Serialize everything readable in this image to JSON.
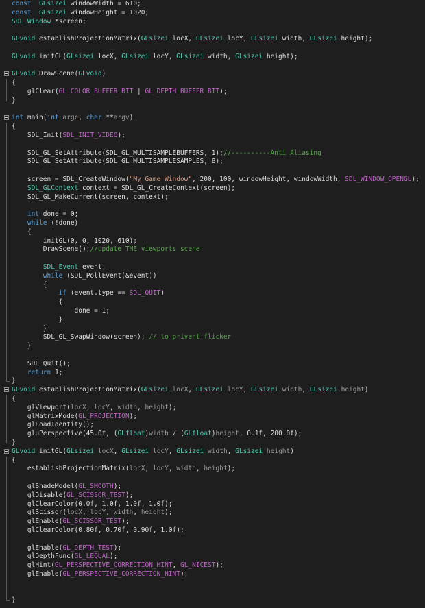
{
  "lines": [
    [
      [
        "kw",
        "const  "
      ],
      [
        "typ",
        "GLsizei"
      ],
      [
        "def",
        " windowWidth = 610;"
      ]
    ],
    [
      [
        "kw",
        "const  "
      ],
      [
        "typ",
        "GLsizei"
      ],
      [
        "def",
        " windowHeight = 1020;"
      ]
    ],
    [
      [
        "typ",
        "SDL_Window"
      ],
      [
        "def",
        " *screen;"
      ]
    ],
    [],
    [
      [
        "typ",
        "GLvoid"
      ],
      [
        "def",
        " establishProjectionMatrix("
      ],
      [
        "typ",
        "GLsizei"
      ],
      [
        "def",
        " locX, "
      ],
      [
        "typ",
        "GLsizei"
      ],
      [
        "def",
        " locY, "
      ],
      [
        "typ",
        "GLsizei"
      ],
      [
        "def",
        " width, "
      ],
      [
        "typ",
        "GLsizei"
      ],
      [
        "def",
        " height);"
      ]
    ],
    [],
    [
      [
        "typ",
        "GLvoid"
      ],
      [
        "def",
        " initGL("
      ],
      [
        "typ",
        "GLsizei"
      ],
      [
        "def",
        " locX, "
      ],
      [
        "typ",
        "GLsizei"
      ],
      [
        "def",
        " locY, "
      ],
      [
        "typ",
        "GLsizei"
      ],
      [
        "def",
        " width, "
      ],
      [
        "typ",
        "GLsizei"
      ],
      [
        "def",
        " height);"
      ]
    ],
    [],
    [
      [
        "typ",
        "GLvoid"
      ],
      [
        "def",
        " DrawScene("
      ],
      [
        "typ",
        "GLvoid"
      ],
      [
        "def",
        ")"
      ]
    ],
    [
      [
        "def",
        "{"
      ]
    ],
    [
      [
        "def",
        "    glClear("
      ],
      [
        "mac",
        "GL_COLOR_BUFFER_BIT"
      ],
      [
        "def",
        " | "
      ],
      [
        "mac",
        "GL_DEPTH_BUFFER_BIT"
      ],
      [
        "def",
        ");"
      ]
    ],
    [
      [
        "def",
        "}"
      ]
    ],
    [],
    [
      [
        "kw",
        "int"
      ],
      [
        "def",
        " main("
      ],
      [
        "kw",
        "int"
      ],
      [
        "par",
        " argc"
      ],
      [
        "def",
        ", "
      ],
      [
        "kw",
        "char"
      ],
      [
        "def",
        " **"
      ],
      [
        "par",
        "argv"
      ],
      [
        "def",
        ")"
      ]
    ],
    [
      [
        "def",
        "{"
      ]
    ],
    [
      [
        "def",
        "    SDL_Init("
      ],
      [
        "mac",
        "SDL_INIT_VIDEO"
      ],
      [
        "def",
        ");"
      ]
    ],
    [],
    [
      [
        "def",
        "    SDL_GL_SetAttribute(SDL_GL_MULTISAMPLEBUFFERS, 1);"
      ],
      [
        "com",
        "//----------Anti Aliasing"
      ]
    ],
    [
      [
        "def",
        "    SDL_GL_SetAttribute(SDL_GL_MULTISAMPLESAMPLES, 8);"
      ]
    ],
    [],
    [
      [
        "def",
        "    screen = SDL_CreateWindow("
      ],
      [
        "str",
        "\"My Game Window\""
      ],
      [
        "def",
        ", 200, 100, windowHeight, windowWidth, "
      ],
      [
        "mac",
        "SDL_WINDOW_OPENGL"
      ],
      [
        "def",
        ");"
      ]
    ],
    [
      [
        "def",
        "    "
      ],
      [
        "typ",
        "SDL_GLContext"
      ],
      [
        "def",
        " context = SDL_GL_CreateContext(screen);"
      ]
    ],
    [
      [
        "def",
        "    SDL_GL_MakeCurrent(screen, context);"
      ]
    ],
    [],
    [
      [
        "def",
        "    "
      ],
      [
        "kw",
        "int"
      ],
      [
        "def",
        " done = 0;"
      ]
    ],
    [
      [
        "def",
        "    "
      ],
      [
        "kw",
        "while"
      ],
      [
        "def",
        " (!done)"
      ]
    ],
    [
      [
        "def",
        "    {"
      ]
    ],
    [
      [
        "def",
        "        initGL(0, 0, 1020, 610);"
      ]
    ],
    [
      [
        "def",
        "        DrawScene();"
      ],
      [
        "com",
        "//update THE viewports scene"
      ]
    ],
    [],
    [
      [
        "def",
        "        "
      ],
      [
        "typ",
        "SDL_Event"
      ],
      [
        "def",
        " event;"
      ]
    ],
    [
      [
        "def",
        "        "
      ],
      [
        "kw",
        "while"
      ],
      [
        "def",
        " (SDL_PollEvent(&event))"
      ]
    ],
    [
      [
        "def",
        "        {"
      ]
    ],
    [
      [
        "def",
        "            "
      ],
      [
        "kw",
        "if"
      ],
      [
        "def",
        " (event.type == "
      ],
      [
        "mac",
        "SDL_QUIT"
      ],
      [
        "def",
        ")"
      ]
    ],
    [
      [
        "def",
        "            {"
      ]
    ],
    [
      [
        "def",
        "                done = 1;"
      ]
    ],
    [
      [
        "def",
        "            }"
      ]
    ],
    [
      [
        "def",
        "        }"
      ]
    ],
    [
      [
        "def",
        "        SDL_GL_SwapWindow(screen); "
      ],
      [
        "com",
        "// to privent flicker"
      ]
    ],
    [
      [
        "def",
        "    }"
      ]
    ],
    [],
    [
      [
        "def",
        "    SDL_Quit();"
      ]
    ],
    [
      [
        "def",
        "    "
      ],
      [
        "kw",
        "return"
      ],
      [
        "def",
        " 1;"
      ]
    ],
    [
      [
        "def",
        "}"
      ]
    ],
    [
      [
        "typ",
        "GLvoid"
      ],
      [
        "def",
        " establishProjectionMatrix("
      ],
      [
        "typ",
        "GLsizei"
      ],
      [
        "par",
        " locX"
      ],
      [
        "def",
        ", "
      ],
      [
        "typ",
        "GLsizei"
      ],
      [
        "par",
        " locY"
      ],
      [
        "def",
        ", "
      ],
      [
        "typ",
        "GLsizei"
      ],
      [
        "par",
        " width"
      ],
      [
        "def",
        ", "
      ],
      [
        "typ",
        "GLsizei"
      ],
      [
        "par",
        " height"
      ],
      [
        "def",
        ")"
      ]
    ],
    [
      [
        "def",
        "{"
      ]
    ],
    [
      [
        "def",
        "    glViewport("
      ],
      [
        "par",
        "locX"
      ],
      [
        "def",
        ", "
      ],
      [
        "par",
        "locY"
      ],
      [
        "def",
        ", "
      ],
      [
        "par",
        "width"
      ],
      [
        "def",
        ", "
      ],
      [
        "par",
        "height"
      ],
      [
        "def",
        ");"
      ]
    ],
    [
      [
        "def",
        "    glMatrixMode("
      ],
      [
        "mac",
        "GL_PROJECTION"
      ],
      [
        "def",
        ");"
      ]
    ],
    [
      [
        "def",
        "    glLoadIdentity();"
      ]
    ],
    [
      [
        "def",
        "    gluPerspective(45.0f, ("
      ],
      [
        "typ",
        "GLfloat"
      ],
      [
        "def",
        ")"
      ],
      [
        "par",
        "width"
      ],
      [
        "def",
        " / ("
      ],
      [
        "typ",
        "GLfloat"
      ],
      [
        "def",
        ")"
      ],
      [
        "par",
        "height"
      ],
      [
        "def",
        ", 0.1f, 200.0f);"
      ]
    ],
    [
      [
        "def",
        "}"
      ]
    ],
    [
      [
        "typ",
        "GLvoid"
      ],
      [
        "def",
        " initGL("
      ],
      [
        "typ",
        "GLsizei"
      ],
      [
        "par",
        " locX"
      ],
      [
        "def",
        ", "
      ],
      [
        "typ",
        "GLsizei"
      ],
      [
        "par",
        " locY"
      ],
      [
        "def",
        ", "
      ],
      [
        "typ",
        "GLsizei"
      ],
      [
        "par",
        " width"
      ],
      [
        "def",
        ", "
      ],
      [
        "typ",
        "GLsizei"
      ],
      [
        "par",
        " height"
      ],
      [
        "def",
        ")"
      ]
    ],
    [
      [
        "def",
        "{"
      ]
    ],
    [
      [
        "def",
        "    establishProjectionMatrix("
      ],
      [
        "par",
        "locX"
      ],
      [
        "def",
        ", "
      ],
      [
        "par",
        "locY"
      ],
      [
        "def",
        ", "
      ],
      [
        "par",
        "width"
      ],
      [
        "def",
        ", "
      ],
      [
        "par",
        "height"
      ],
      [
        "def",
        ");"
      ]
    ],
    [],
    [
      [
        "def",
        "    glShadeModel("
      ],
      [
        "mac",
        "GL_SMOOTH"
      ],
      [
        "def",
        ");"
      ]
    ],
    [
      [
        "def",
        "    glDisable("
      ],
      [
        "mac",
        "GL_SCISSOR_TEST"
      ],
      [
        "def",
        ");"
      ]
    ],
    [
      [
        "def",
        "    glClearColor(0.0f, 1.0f, 1.0f, 1.0f);"
      ]
    ],
    [
      [
        "def",
        "    glScissor("
      ],
      [
        "par",
        "locX"
      ],
      [
        "def",
        ", "
      ],
      [
        "par",
        "locY"
      ],
      [
        "def",
        ", "
      ],
      [
        "par",
        "width"
      ],
      [
        "def",
        ", "
      ],
      [
        "par",
        "height"
      ],
      [
        "def",
        ");"
      ]
    ],
    [
      [
        "def",
        "    glEnable("
      ],
      [
        "mac",
        "GL_SCISSOR_TEST"
      ],
      [
        "def",
        ");"
      ]
    ],
    [
      [
        "def",
        "    glClearColor(0.80f, 0.70f, 0.90f, 1.0f);"
      ]
    ],
    [],
    [
      [
        "def",
        "    glEnable("
      ],
      [
        "mac",
        "GL_DEPTH_TEST"
      ],
      [
        "def",
        ");"
      ]
    ],
    [
      [
        "def",
        "    glDepthFunc("
      ],
      [
        "mac",
        "GL_LEQUAL"
      ],
      [
        "def",
        ");"
      ]
    ],
    [
      [
        "def",
        "    glHint("
      ],
      [
        "mac",
        "GL_PERSPECTIVE_CORRECTION_HINT"
      ],
      [
        "def",
        ", "
      ],
      [
        "mac",
        "GL_NICEST"
      ],
      [
        "def",
        ");"
      ]
    ],
    [
      [
        "def",
        "    glEnable("
      ],
      [
        "mac",
        "GL_PERSPECTIVE_CORRECTION_HINT"
      ],
      [
        "def",
        ");"
      ]
    ],
    [],
    [],
    [
      [
        "def",
        "}"
      ]
    ]
  ],
  "gutter": {
    "8": "fold",
    "9": "guide",
    "10": "guide",
    "11": "end",
    "13": "fold",
    "14": "guide",
    "15": "guide",
    "16": "guide",
    "17": "guide",
    "18": "guide",
    "19": "guide",
    "20": "guide",
    "21": "guide",
    "22": "guide",
    "23": "guide",
    "24": "guide",
    "25": "guide",
    "26": "guide",
    "27": "guide",
    "28": "guide",
    "29": "guide",
    "30": "guide",
    "31": "guide",
    "32": "guide",
    "33": "guide",
    "34": "guide",
    "35": "guide",
    "36": "guide",
    "37": "guide",
    "38": "guide",
    "39": "guide",
    "40": "guide",
    "41": "guide",
    "42": "guide",
    "43": "end",
    "44": "fold",
    "45": "guide",
    "46": "guide",
    "47": "guide",
    "48": "guide",
    "49": "guide",
    "50": "end",
    "51": "fold",
    "52": "guide",
    "53": "guide",
    "54": "guide",
    "55": "guide",
    "56": "guide",
    "57": "guide",
    "58": "guide",
    "59": "guide",
    "60": "guide",
    "61": "guide",
    "62": "guide",
    "63": "guide",
    "64": "guide",
    "65": "guide",
    "66": "guide",
    "67": "guide",
    "68": "end"
  },
  "colors": {
    "background": "#1e1e1e",
    "keyword": "#569cd6",
    "type": "#4ec9b0",
    "macro": "#bd63c5",
    "string": "#d69d85",
    "comment": "#57a64a",
    "parameter": "#9a9a9a",
    "default": "#dcdcdc"
  }
}
